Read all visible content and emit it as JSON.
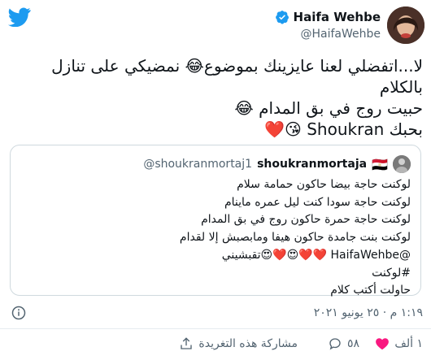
{
  "author": {
    "name": "Haifa Wehbe",
    "handle": "@HaifaWehbe"
  },
  "tweet": {
    "text": "لا...اتفضلي لعنا عايزينك بموضوع😂 نمضيكي على تنازل بالكلام\nحبيت روج في بق المدام 😂\nبحبك Shoukran 😘❤️"
  },
  "quoted": {
    "name": "shoukranmortaja",
    "flag": "🇪🇬",
    "handle": "@shoukranmortaj1",
    "text": "لوكنت حاجة بيضا حاكون حمامة سلام\nلوكنت حاجة سودا كنت ليل عمره ماينام\nلوكنت حاجة حمرة حاكون روج في بق المدام\nلوكنت بنت جامدة حاكون هيفا ومابصبش إلا لقدام\n@HaifaWehbe ❤️❤️😍❤️😍تقبشيني\n#لوكنت\nحاولت أكتب كلام"
  },
  "timestamp": "١:١٩ م · ٢٥ يونيو ٢٠٢١",
  "actions": {
    "likes": "١ ألف",
    "replies": "٥٨",
    "share": "مشاركة هذه التغريدة"
  },
  "colors": {
    "brand_blue": "#1d9bf0",
    "heart_red": "#f91880",
    "muted": "#536471"
  }
}
